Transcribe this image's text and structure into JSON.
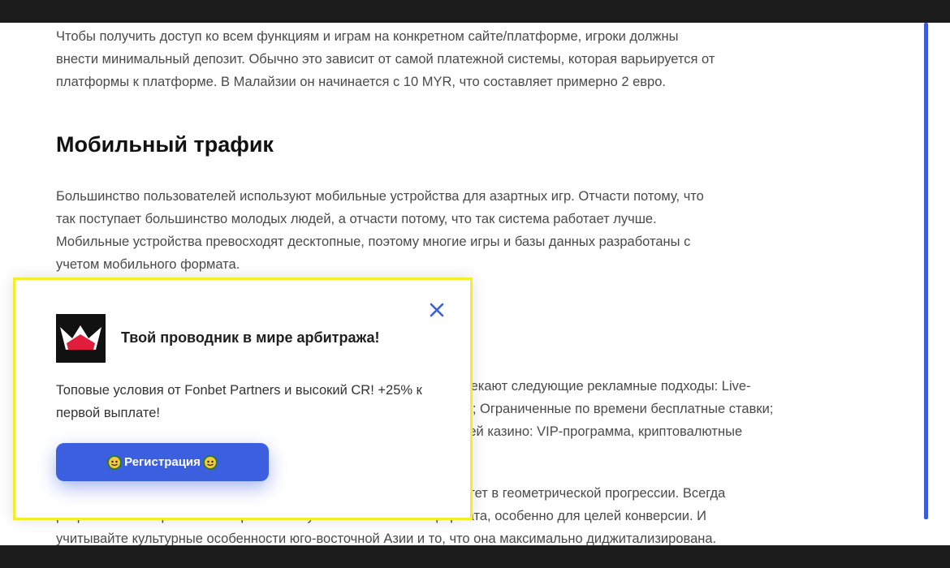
{
  "article": {
    "paragraph1": [
      "Чтобы получить доступ ко всем функциям и играм на конкретном сайте/платформе, игроки должны",
      "внести минимальный депозит. Обычно это зависит от самой платежной системы, которая варьируется от",
      "платформы к платформе. В Малайзии он начинается с 10 MYR, что составляет примерно 2 евро."
    ],
    "heading": "Мобильный трафик",
    "paragraph2": [
      "Большинство пользователей используют мобильные устройства для азартных игр. Отчасти потому, что",
      "так поступает большинство молодых людей, а отчасти потому, что так система работает лучше.",
      "Мобильные устройства превосходят десктопные, поэтому многие игры и базы данных разработаны с",
      "учетом мобильного формата."
    ],
    "paragraph3_visible": [
      "лекают следующие рекламные подходы: Live-",
      "ы; Ограниченные по времени бесплатные ставки;",
      "тей казино: VIP-программа, криптовалютные"
    ],
    "paragraph4_visible": [
      "стет в геометрической прогрессии. Всегда",
      "разрабатывайте рекламные креативы с учетом мобильного формата, особенно для целей конверсии. И",
      "учитывайте культурные особенности юго-восточной Азии и то, что она максимально диджитализирована."
    ]
  },
  "popup": {
    "title": "Твой проводник в мире арбитража!",
    "text": "Топовые условия от Fonbet Partners и высокий CR! +25% к первой выплате!",
    "button_label": "Регистрация",
    "logo_icon": "crown-logo-icon",
    "close_icon": "close-icon",
    "accent_color": "#3c5fe0",
    "highlight_border_color": "#f2ee2a"
  },
  "colors": {
    "scrollbar": "#3b5bdb"
  }
}
